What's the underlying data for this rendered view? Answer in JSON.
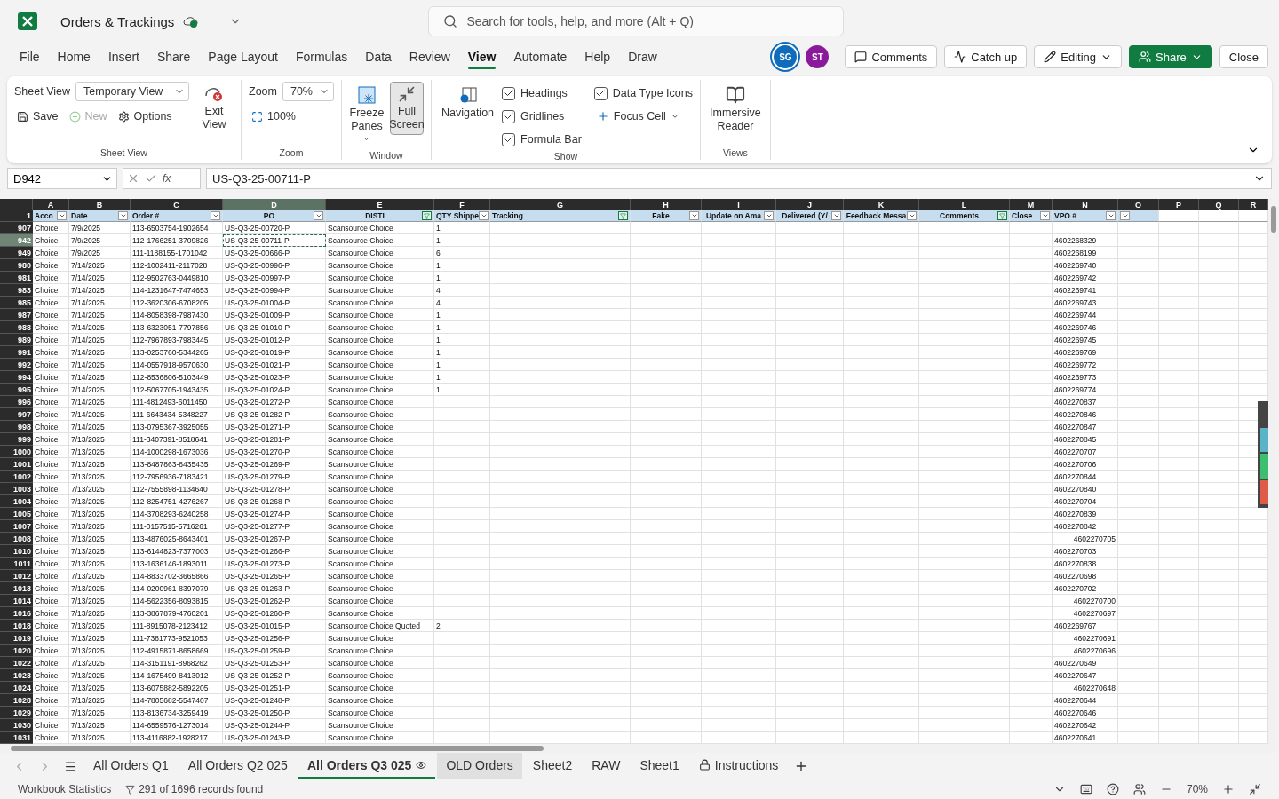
{
  "title_bar": {
    "title": "Orders & Trackings",
    "search_placeholder": "Search for tools, help, and more (Alt + Q)"
  },
  "menu_tabs": [
    {
      "label": "File",
      "selected": false
    },
    {
      "label": "Home",
      "selected": false
    },
    {
      "label": "Insert",
      "selected": false
    },
    {
      "label": "Share",
      "selected": false
    },
    {
      "label": "Page Layout",
      "selected": false
    },
    {
      "label": "Formulas",
      "selected": false
    },
    {
      "label": "Data",
      "selected": false
    },
    {
      "label": "Review",
      "selected": false
    },
    {
      "label": "View",
      "selected": true
    },
    {
      "label": "Automate",
      "selected": false
    },
    {
      "label": "Help",
      "selected": false
    },
    {
      "label": "Draw",
      "selected": false
    }
  ],
  "avatars": [
    {
      "initials": "SG",
      "color": "#0f6cbd",
      "ring": true
    },
    {
      "initials": "ST",
      "color": "#8a1a9b",
      "ring": false
    }
  ],
  "actions": [
    {
      "kind": "comments",
      "label": "Comments"
    },
    {
      "kind": "catchup",
      "label": "Catch up"
    },
    {
      "kind": "editing",
      "label": "Editing"
    },
    {
      "kind": "share",
      "label": "Share"
    },
    {
      "kind": "close",
      "label": "Close"
    }
  ],
  "ribbon_groups": [
    {
      "kind": "sheet_view",
      "title": "Sheet View",
      "label": "Sheet View",
      "view": "Temporary View",
      "buttons": [
        {
          "label": "Save",
          "disabled": false
        },
        {
          "label": "New",
          "disabled": true
        },
        {
          "label": "Options",
          "disabled": false
        }
      ],
      "exit": "Exit View"
    },
    {
      "kind": "zoom",
      "title": "Zoom",
      "label": "Zoom",
      "value": "70%",
      "reset": "100%"
    },
    {
      "kind": "window",
      "title": "Window",
      "buttons": [
        {
          "label": "Freeze Panes",
          "selected": false,
          "dropdown": true
        },
        {
          "label": "Full Screen",
          "selected": true,
          "dropdown": false
        }
      ]
    },
    {
      "kind": "show",
      "title": "Show",
      "navigation": "Navigation",
      "checks": [
        {
          "label": "Headings",
          "checked": true
        },
        {
          "label": "Gridlines",
          "checked": true
        },
        {
          "label": "Formula Bar",
          "checked": true
        },
        {
          "label": "Data Type Icons",
          "checked": true
        }
      ],
      "focus": "Focus Cell"
    },
    {
      "kind": "views",
      "title": "Views",
      "buttons": [
        {
          "label": "Immersive Reader"
        }
      ]
    }
  ],
  "formula_bar": {
    "name_box": "D942",
    "fx_label": "fx",
    "formula": "US-Q3-25-00711-P"
  },
  "header_row": "1",
  "columns": [
    {
      "letter": "A",
      "header": "Acco",
      "dropdown": true,
      "filtered": false,
      "selected": false
    },
    {
      "letter": "B",
      "header": "Date",
      "dropdown": true,
      "filtered": false,
      "selected": false
    },
    {
      "letter": "C",
      "header": "Order #",
      "dropdown": true,
      "filtered": false,
      "selected": false
    },
    {
      "letter": "D",
      "header": "PO",
      "dropdown": true,
      "filtered": false,
      "selected": true
    },
    {
      "letter": "E",
      "header": "DISTI",
      "dropdown": true,
      "filtered": true,
      "selected": false
    },
    {
      "letter": "F",
      "header": "QTY Shippe",
      "dropdown": true,
      "filtered": false,
      "selected": false
    },
    {
      "letter": "G",
      "header": "Tracking",
      "dropdown": true,
      "filtered": true,
      "selected": false
    },
    {
      "letter": "H",
      "header": "Fake",
      "dropdown": true,
      "filtered": false,
      "selected": false
    },
    {
      "letter": "I",
      "header": "Update on Ama",
      "dropdown": true,
      "filtered": false,
      "selected": false
    },
    {
      "letter": "J",
      "header": "Delivered (Y/",
      "dropdown": true,
      "filtered": false,
      "selected": false
    },
    {
      "letter": "K",
      "header": "Feedback Messa",
      "dropdown": true,
      "filtered": false,
      "selected": false
    },
    {
      "letter": "L",
      "header": "Comments",
      "dropdown": true,
      "filtered": true,
      "selected": false
    },
    {
      "letter": "M",
      "header": "Close",
      "dropdown": true,
      "filtered": false,
      "selected": false
    },
    {
      "letter": "N",
      "header": "VPO #",
      "dropdown": true,
      "filtered": false,
      "selected": false
    },
    {
      "letter": "O",
      "dropdown": true,
      "filtered": false,
      "selected": false
    },
    {
      "letter": "P",
      "dropdown": false,
      "selected": false
    },
    {
      "letter": "Q",
      "dropdown": false,
      "selected": false
    },
    {
      "letter": "R",
      "dropdown": false,
      "selected": false
    }
  ],
  "rows": [
    {
      "row": "907",
      "selected": false,
      "account": "Choice",
      "date": "7/9/2025",
      "order": "113-6503754-1902654",
      "po": "US-Q3-25-00720-P",
      "disti": "Scansource Choice",
      "qty": "1"
    },
    {
      "row": "942",
      "selected": true,
      "account": "Choice",
      "date": "7/9/2025",
      "order": "112-1766251-3709826",
      "po": "US-Q3-25-00711-P",
      "disti": "Scansource Choice",
      "qty": "1",
      "vpo": "4602268329",
      "vpo_numeric": false
    },
    {
      "row": "949",
      "selected": false,
      "account": "Choice",
      "date": "7/9/2025",
      "order": "111-1188155-1701042",
      "po": "US-Q3-25-00666-P",
      "disti": "Scansource Choice",
      "qty": "6",
      "vpo": "4602268199",
      "vpo_numeric": false
    },
    {
      "row": "980",
      "selected": false,
      "account": "Choice",
      "date": "7/14/2025",
      "order": "112-1002411-2117028",
      "po": "US-Q3-25-00996-P",
      "disti": "Scansource Choice",
      "qty": "1",
      "vpo": "4602269740",
      "vpo_numeric": false
    },
    {
      "row": "981",
      "selected": false,
      "account": "Choice",
      "date": "7/14/2025",
      "order": "112-9502763-0449810",
      "po": "US-Q3-25-00997-P",
      "disti": "Scansource Choice",
      "qty": "1",
      "vpo": "4602269742",
      "vpo_numeric": false
    },
    {
      "row": "983",
      "selected": false,
      "account": "Choice",
      "date": "7/14/2025",
      "order": "114-1231647-7474653",
      "po": "US-Q3-25-00994-P",
      "disti": "Scansource Choice",
      "qty": "4",
      "vpo": "4602269741",
      "vpo_numeric": false
    },
    {
      "row": "985",
      "selected": false,
      "account": "Choice",
      "date": "7/14/2025",
      "order": "112-3620306-6708205",
      "po": "US-Q3-25-01004-P",
      "disti": "Scansource Choice",
      "qty": "4",
      "vpo": "4602269743",
      "vpo_numeric": false
    },
    {
      "row": "987",
      "selected": false,
      "account": "Choice",
      "date": "7/14/2025",
      "order": "114-8058398-7987430",
      "po": "US-Q3-25-01009-P",
      "disti": "Scansource Choice",
      "qty": "1",
      "vpo": "4602269744",
      "vpo_numeric": false
    },
    {
      "row": "988",
      "selected": false,
      "account": "Choice",
      "date": "7/14/2025",
      "order": "113-6323051-7797856",
      "po": "US-Q3-25-01010-P",
      "disti": "Scansource Choice",
      "qty": "1",
      "vpo": "4602269746",
      "vpo_numeric": false
    },
    {
      "row": "989",
      "selected": false,
      "account": "Choice",
      "date": "7/14/2025",
      "order": "112-7967893-7983445",
      "po": "US-Q3-25-01012-P",
      "disti": "Scansource Choice",
      "qty": "1",
      "vpo": "4602269745",
      "vpo_numeric": false
    },
    {
      "row": "991",
      "selected": false,
      "account": "Choice",
      "date": "7/14/2025",
      "order": "113-0253760-5344265",
      "po": "US-Q3-25-01019-P",
      "disti": "Scansource Choice",
      "qty": "1",
      "vpo": "4602269769",
      "vpo_numeric": false
    },
    {
      "row": "992",
      "selected": false,
      "account": "Choice",
      "date": "7/14/2025",
      "order": "114-0557918-9570630",
      "po": "US-Q3-25-01021-P",
      "disti": "Scansource Choice",
      "qty": "1",
      "vpo": "4602269772",
      "vpo_numeric": false
    },
    {
      "row": "994",
      "selected": false,
      "account": "Choice",
      "date": "7/14/2025",
      "order": "112-8536806-5103449",
      "po": "US-Q3-25-01023-P",
      "disti": "Scansource Choice",
      "qty": "1",
      "vpo": "4602269773",
      "vpo_numeric": false
    },
    {
      "row": "995",
      "selected": false,
      "account": "Choice",
      "date": "7/14/2025",
      "order": "112-5067705-1943435",
      "po": "US-Q3-25-01024-P",
      "disti": "Scansource Choice",
      "qty": "1",
      "vpo": "4602269774",
      "vpo_numeric": false
    },
    {
      "row": "996",
      "selected": false,
      "account": "Choice",
      "date": "7/14/2025",
      "order": "111-4812493-6011450",
      "po": "US-Q3-25-01272-P",
      "disti": "Scansource Choice",
      "vpo": "4602270837",
      "vpo_numeric": false
    },
    {
      "row": "997",
      "selected": false,
      "account": "Choice",
      "date": "7/14/2025",
      "order": "111-6643434-5348227",
      "po": "US-Q3-25-01282-P",
      "disti": "Scansource Choice",
      "vpo": "4602270846",
      "vpo_numeric": false
    },
    {
      "row": "998",
      "selected": false,
      "account": "Choice",
      "date": "7/14/2025",
      "order": "113-0795367-3925055",
      "po": "US-Q3-25-01271-P",
      "disti": "Scansource Choice",
      "vpo": "4602270847",
      "vpo_numeric": false
    },
    {
      "row": "999",
      "selected": false,
      "account": "Choice",
      "date": "7/13/2025",
      "order": "111-3407391-8518641",
      "po": "US-Q3-25-01281-P",
      "disti": "Scansource Choice",
      "vpo": "4602270845",
      "vpo_numeric": false
    },
    {
      "row": "1000",
      "selected": false,
      "account": "Choice",
      "date": "7/13/2025",
      "order": "114-1000298-1673036",
      "po": "US-Q3-25-01270-P",
      "disti": "Scansource Choice",
      "vpo": "4602270707",
      "vpo_numeric": false
    },
    {
      "row": "1001",
      "selected": false,
      "account": "Choice",
      "date": "7/13/2025",
      "order": "113-8487863-8435435",
      "po": "US-Q3-25-01269-P",
      "disti": "Scansource Choice",
      "vpo": "4602270706",
      "vpo_numeric": false
    },
    {
      "row": "1002",
      "selected": false,
      "account": "Choice",
      "date": "7/13/2025",
      "order": "112-7956936-7183421",
      "po": "US-Q3-25-01279-P",
      "disti": "Scansource Choice",
      "vpo": "4602270844",
      "vpo_numeric": false
    },
    {
      "row": "1003",
      "selected": false,
      "account": "Choice",
      "date": "7/13/2025",
      "order": "112-7555898-1134640",
      "po": "US-Q3-25-01278-P",
      "disti": "Scansource Choice",
      "vpo": "4602270840",
      "vpo_numeric": false
    },
    {
      "row": "1004",
      "selected": false,
      "account": "Choice",
      "date": "7/13/2025",
      "order": "112-8254751-4276267",
      "po": "US-Q3-25-01268-P",
      "disti": "Scansource Choice",
      "vpo": "4602270704",
      "vpo_numeric": false
    },
    {
      "row": "1005",
      "selected": false,
      "account": "Choice",
      "date": "7/13/2025",
      "order": "114-3708293-6240258",
      "po": "US-Q3-25-01274-P",
      "disti": "Scansource Choice",
      "vpo": "4602270839",
      "vpo_numeric": false
    },
    {
      "row": "1007",
      "selected": false,
      "account": "Choice",
      "date": "7/13/2025",
      "order": "111-0157515-5716261",
      "po": "US-Q3-25-01277-P",
      "disti": "Scansource Choice",
      "vpo": "4602270842",
      "vpo_numeric": false
    },
    {
      "row": "1008",
      "selected": false,
      "account": "Choice",
      "date": "7/13/2025",
      "order": "113-4876025-8643401",
      "po": "US-Q3-25-01267-P",
      "disti": "Scansource Choice",
      "vpo": "4602270705",
      "vpo_numeric": true
    },
    {
      "row": "1010",
      "selected": false,
      "account": "Choice",
      "date": "7/13/2025",
      "order": "113-6144823-7377003",
      "po": "US-Q3-25-01266-P",
      "disti": "Scansource Choice",
      "vpo": "4602270703",
      "vpo_numeric": false
    },
    {
      "row": "1011",
      "selected": false,
      "account": "Choice",
      "date": "7/13/2025",
      "order": "113-1636146-1893011",
      "po": "US-Q3-25-01273-P",
      "disti": "Scansource Choice",
      "vpo": "4602270838",
      "vpo_numeric": false
    },
    {
      "row": "1012",
      "selected": false,
      "account": "Choice",
      "date": "7/13/2025",
      "order": "114-8833702-3665866",
      "po": "US-Q3-25-01265-P",
      "disti": "Scansource Choice",
      "vpo": "4602270698",
      "vpo_numeric": false
    },
    {
      "row": "1013",
      "selected": false,
      "account": "Choice",
      "date": "7/13/2025",
      "order": "114-0200961-8397079",
      "po": "US-Q3-25-01263-P",
      "disti": "Scansource Choice",
      "vpo": "4602270702",
      "vpo_numeric": false
    },
    {
      "row": "1014",
      "selected": false,
      "account": "Choice",
      "date": "7/13/2025",
      "order": "114-5622356-8093815",
      "po": "US-Q3-25-01262-P",
      "disti": "Scansource Choice",
      "vpo": "4602270700",
      "vpo_numeric": true
    },
    {
      "row": "1016",
      "selected": false,
      "account": "Choice",
      "date": "7/13/2025",
      "order": "113-3867879-4760201",
      "po": "US-Q3-25-01260-P",
      "disti": "Scansource Choice",
      "vpo": "4602270697",
      "vpo_numeric": true
    },
    {
      "row": "1018",
      "selected": false,
      "account": "Choice",
      "date": "7/13/2025",
      "order": "111-8915078-2123412",
      "po": "US-Q3-25-01015-P",
      "disti": "Scansource Choice Quoted",
      "qty": "2",
      "vpo": "4602269767",
      "vpo_numeric": false
    },
    {
      "row": "1019",
      "selected": false,
      "account": "Choice",
      "date": "7/13/2025",
      "order": "111-7381773-9521053",
      "po": "US-Q3-25-01256-P",
      "disti": "Scansource Choice",
      "vpo": "4602270691",
      "vpo_numeric": true
    },
    {
      "row": "1020",
      "selected": false,
      "account": "Choice",
      "date": "7/13/2025",
      "order": "112-4915871-8658669",
      "po": "US-Q3-25-01259-P",
      "disti": "Scansource Choice",
      "vpo": "4602270696",
      "vpo_numeric": true
    },
    {
      "row": "1022",
      "selected": false,
      "account": "Choice",
      "date": "7/13/2025",
      "order": "114-3151191-8968262",
      "po": "US-Q3-25-01253-P",
      "disti": "Scansource Choice",
      "vpo": "4602270649",
      "vpo_numeric": false
    },
    {
      "row": "1023",
      "selected": false,
      "account": "Choice",
      "date": "7/13/2025",
      "order": "114-1675499-8413012",
      "po": "US-Q3-25-01252-P",
      "disti": "Scansource Choice",
      "vpo": "4602270647",
      "vpo_numeric": false
    },
    {
      "row": "1024",
      "selected": false,
      "account": "Choice",
      "date": "7/13/2025",
      "order": "113-6075882-5892205",
      "po": "US-Q3-25-01251-P",
      "disti": "Scansource Choice",
      "vpo": "4602270648",
      "vpo_numeric": true
    },
    {
      "row": "1028",
      "selected": false,
      "account": "Choice",
      "date": "7/13/2025",
      "order": "114-7805682-5547407",
      "po": "US-Q3-25-01248-P",
      "disti": "Scansource Choice",
      "vpo": "4602270644",
      "vpo_numeric": false
    },
    {
      "row": "1029",
      "selected": false,
      "account": "Choice",
      "date": "7/13/2025",
      "order": "113-8136734-3259419",
      "po": "US-Q3-25-01250-P",
      "disti": "Scansource Choice",
      "vpo": "4602270646",
      "vpo_numeric": false
    },
    {
      "row": "1030",
      "selected": false,
      "account": "Choice",
      "date": "7/13/2025",
      "order": "114-6559576-1273014",
      "po": "US-Q3-25-01244-P",
      "disti": "Scansource Choice",
      "vpo": "4602270642",
      "vpo_numeric": false
    },
    {
      "row": "1031",
      "selected": false,
      "account": "Choice",
      "date": "7/13/2025",
      "order": "113-4116882-1928217",
      "po": "US-Q3-25-01243-P",
      "disti": "Scansource Choice",
      "vpo": "4602270641",
      "vpo_numeric": false
    }
  ],
  "sheet_tabs": [
    {
      "label": "All Orders Q1",
      "selected": false,
      "hover": false,
      "kind": "plain"
    },
    {
      "label": "All Orders Q2 025",
      "selected": false,
      "hover": false,
      "kind": "plain"
    },
    {
      "label": "All Orders Q3 025",
      "selected": true,
      "hover": false,
      "kind": "watched"
    },
    {
      "label": "OLD Orders",
      "selected": false,
      "hover": true,
      "kind": "plain"
    },
    {
      "label": "Sheet2",
      "selected": false,
      "hover": false,
      "kind": "plain"
    },
    {
      "label": "RAW",
      "selected": false,
      "hover": false,
      "kind": "plain"
    },
    {
      "label": "Sheet1",
      "selected": false,
      "hover": false,
      "kind": "plain"
    },
    {
      "label": "Instructions",
      "selected": false,
      "hover": false,
      "kind": "protected"
    }
  ],
  "status_bar": {
    "statistics": "Workbook Statistics",
    "records": "291 of 1696 records found",
    "zoom": "70%"
  }
}
